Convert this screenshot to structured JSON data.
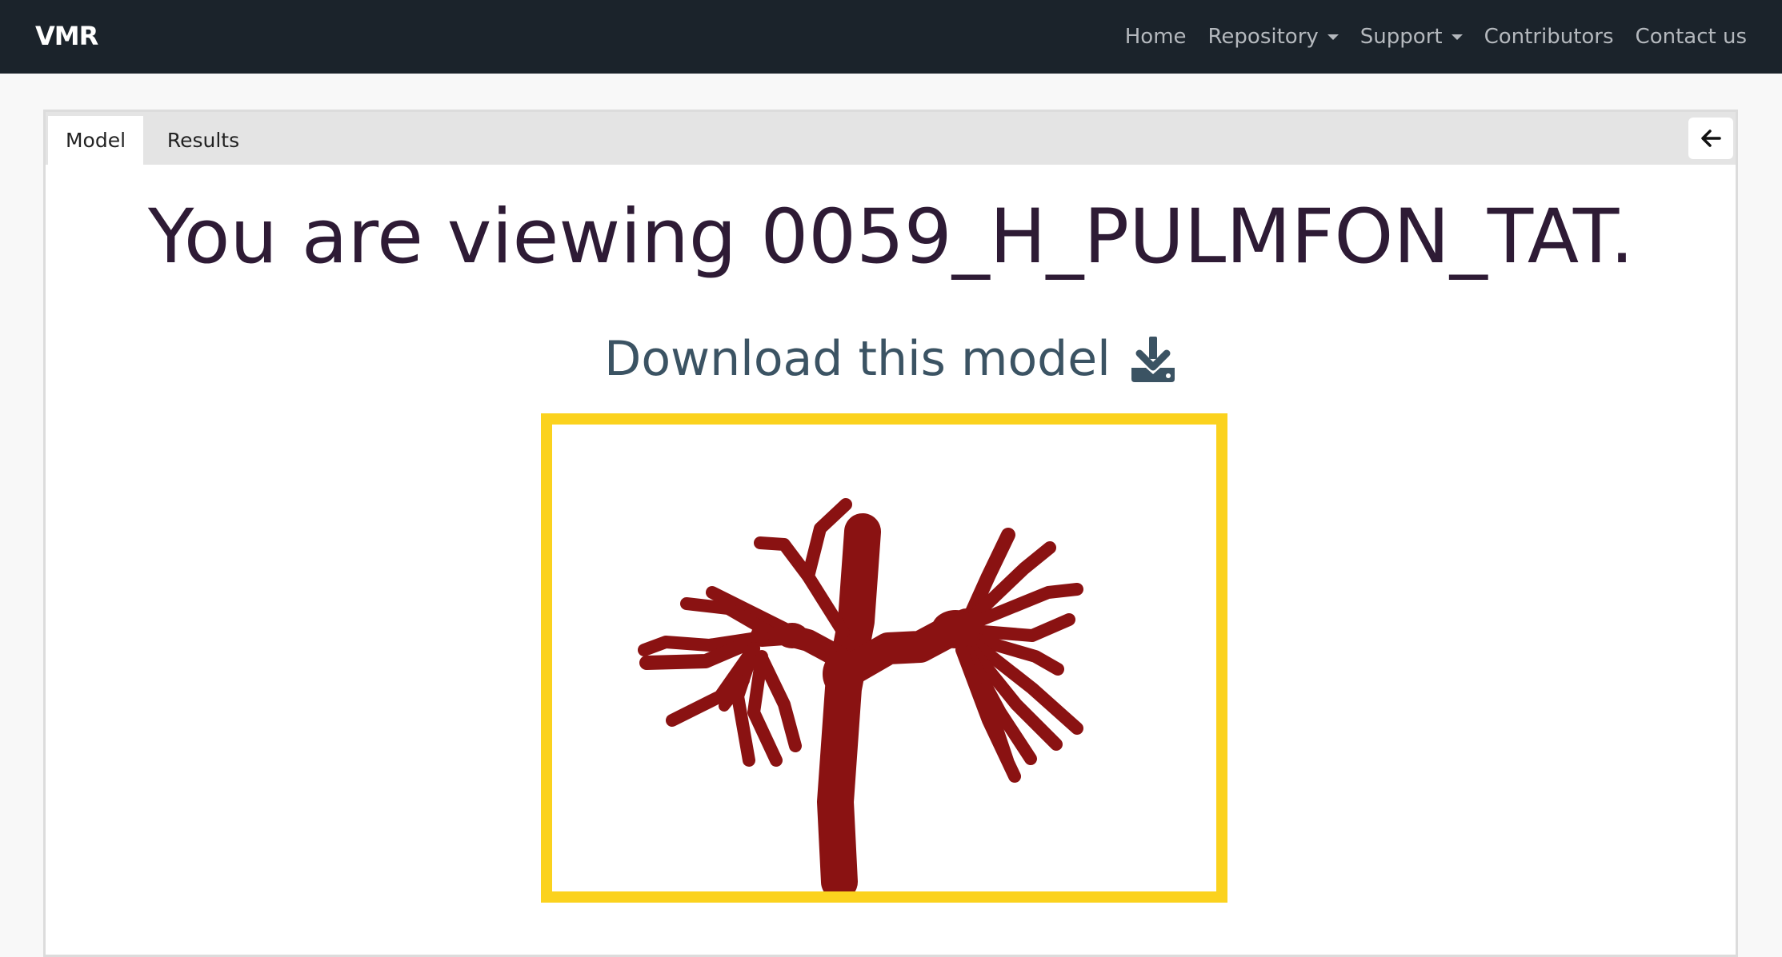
{
  "nav": {
    "brand": "VMR",
    "links": [
      {
        "label": "Home",
        "dropdown": false
      },
      {
        "label": "Repository",
        "dropdown": true
      },
      {
        "label": "Support",
        "dropdown": true
      },
      {
        "label": "Contributors",
        "dropdown": false
      },
      {
        "label": "Contact us",
        "dropdown": false
      }
    ]
  },
  "tabs": [
    {
      "label": "Model",
      "active": true
    },
    {
      "label": "Results",
      "active": false
    }
  ],
  "main": {
    "title": "You are viewing 0059_H_PULMFON_TAT.",
    "download_label": "Download this model"
  },
  "icons": {
    "back": "arrow-left-icon",
    "download": "download-icon"
  },
  "colors": {
    "navbar_bg": "#1b232b",
    "frame_border": "#fbd21e",
    "model_red": "#8a1212",
    "title_text": "#2e1b35",
    "download_text": "#3b5363"
  }
}
